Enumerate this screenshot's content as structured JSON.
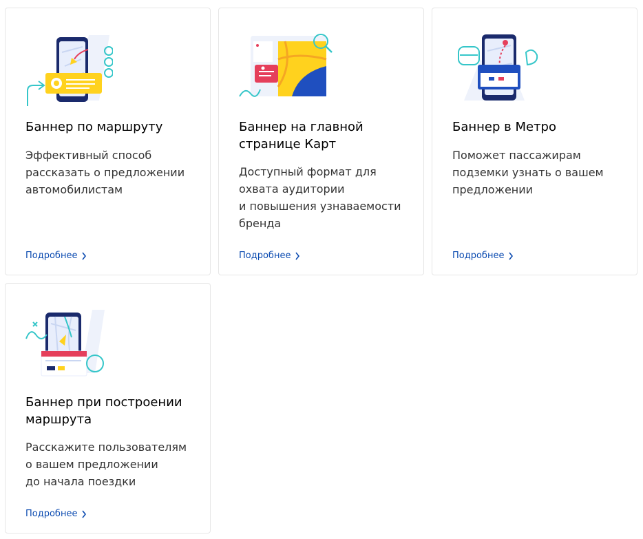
{
  "cards": [
    {
      "title": "Баннер по маршруту",
      "description": "Эффективный способ\nрассказать о предложении\nавтомобилистам",
      "link": "Подробнее"
    },
    {
      "title": "Баннер на главной\nстранице Карт",
      "description": "Доступный формат для\nохвата аудитории\nи повышения узнаваемости\nбренда",
      "link": "Подробнее"
    },
    {
      "title": "Баннер в Метро",
      "description": "Поможет пассажирам\nподземки узнать о вашем\nпредложении",
      "link": "Подробнее"
    },
    {
      "title": "Баннер при построении\nмаршрута",
      "description": "Расскажите пользователям\nо вашем предложении\nдо начала поездки",
      "link": "Подробнее"
    }
  ],
  "colors": {
    "link": "#0a4ab0",
    "accent_yellow": "#ffd21e",
    "accent_cyan": "#35c6c9",
    "accent_red": "#e53f5b",
    "phone_navy": "#1a2a6c"
  },
  "icons": [
    "route-banner-illustration",
    "maps-main-banner-illustration",
    "metro-banner-illustration",
    "route-building-banner-illustration",
    "chevron-right-icon"
  ]
}
